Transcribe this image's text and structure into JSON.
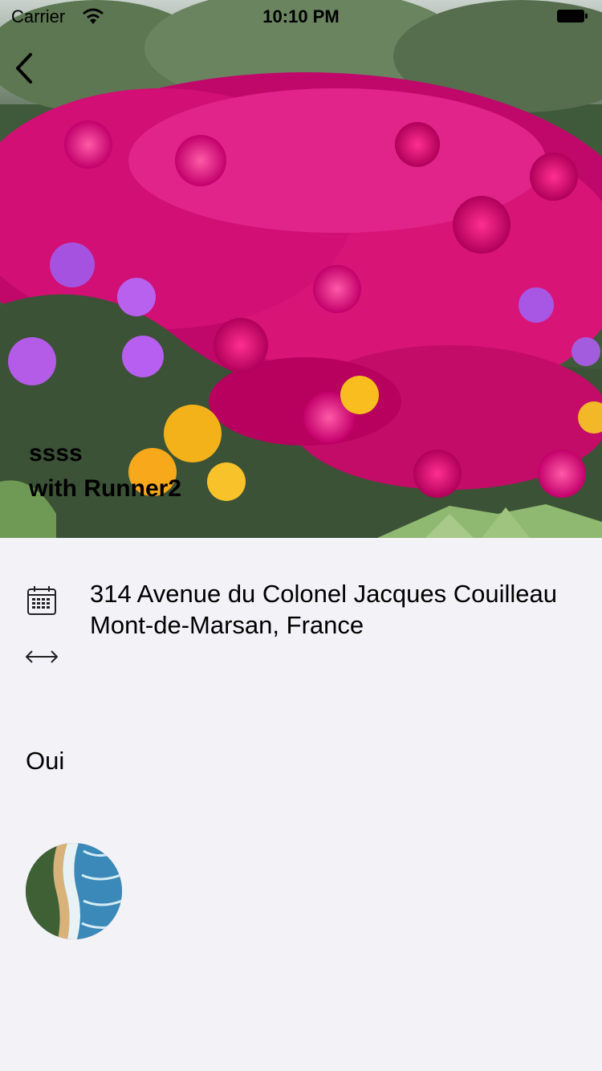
{
  "status_bar": {
    "carrier": "Carrier",
    "time": "10:10 PM"
  },
  "hero": {
    "title": "ssss",
    "subtitle": "with Runner2"
  },
  "details": {
    "address": "314 Avenue du Colonel Jacques Couilleau Mont-de-Marsan, France",
    "answer": "Oui"
  },
  "icons": {
    "back": "chevron-left-icon",
    "calendar": "calendar-icon",
    "distance": "left-right-arrow-icon"
  }
}
